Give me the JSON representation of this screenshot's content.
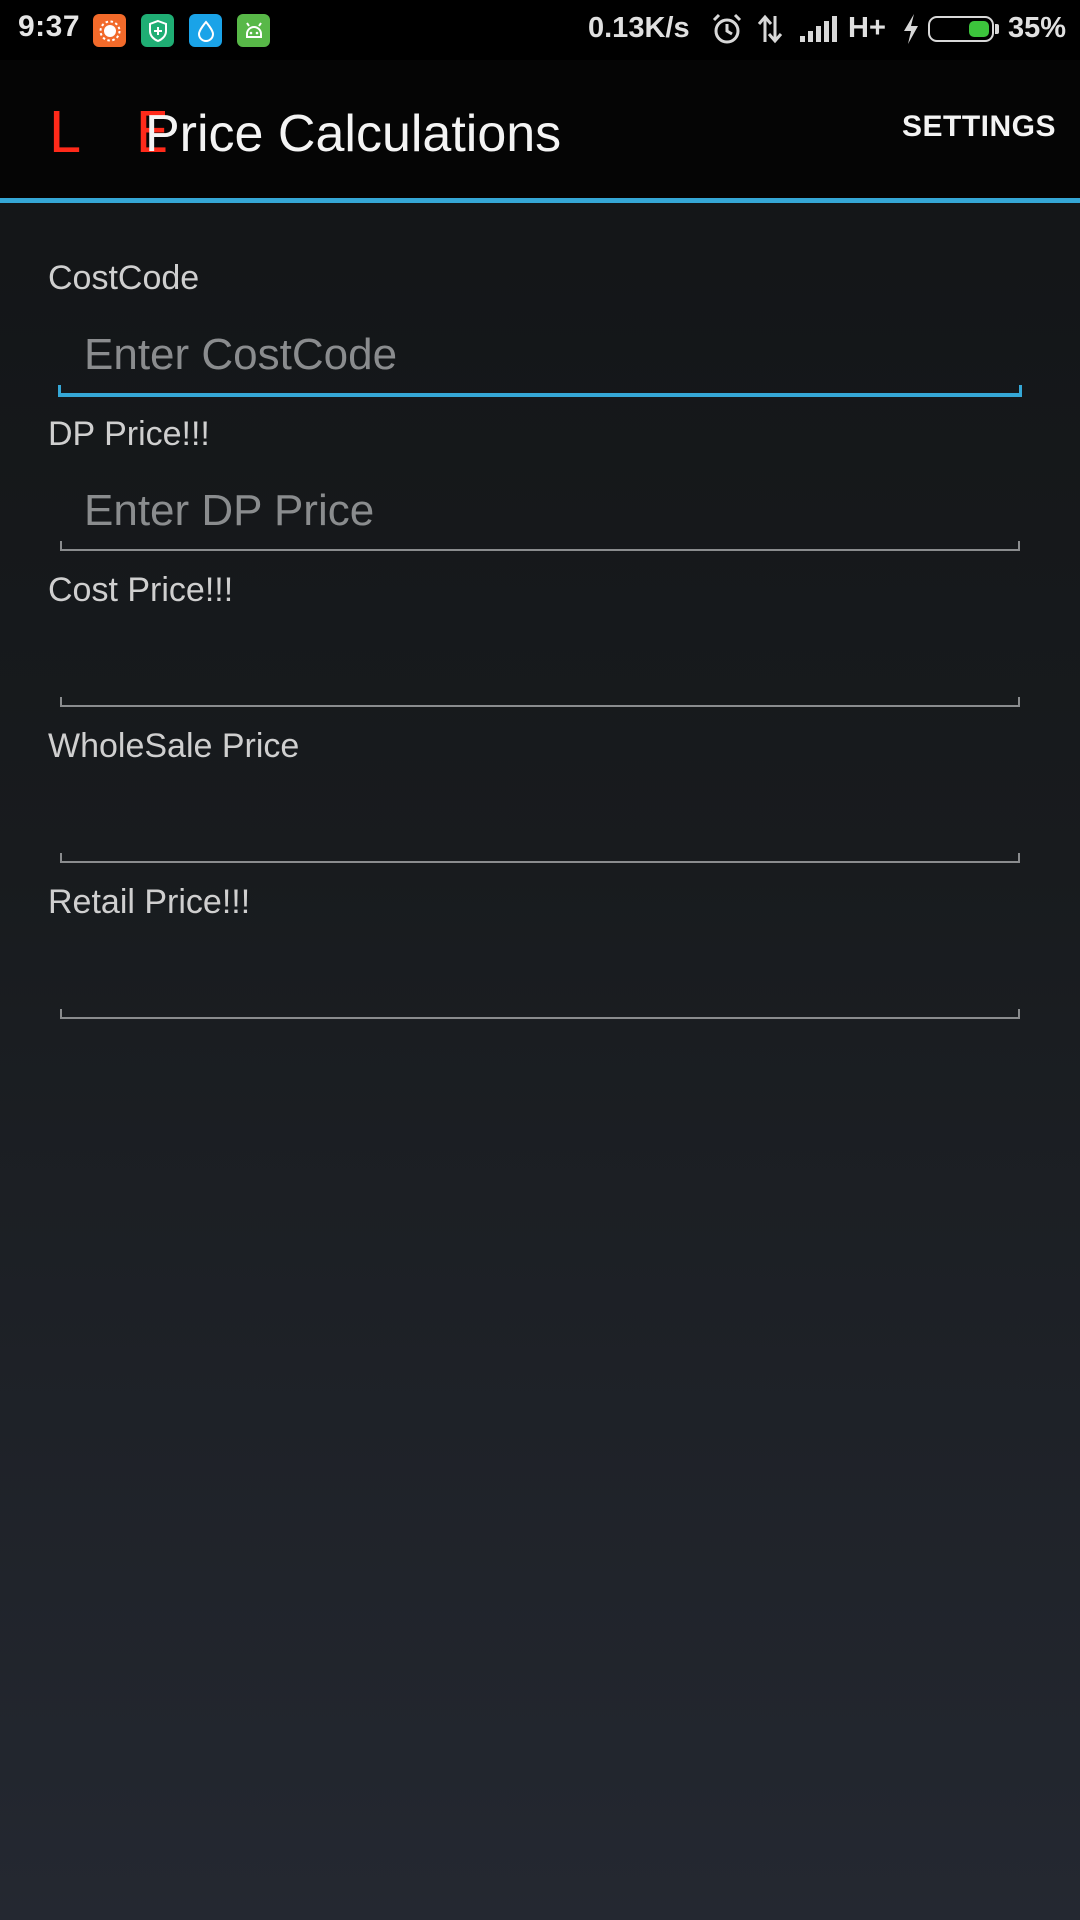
{
  "status_bar": {
    "time": "9:37",
    "notification_icons": [
      "weather-sun-icon",
      "shield-plus-icon",
      "water-drop-icon",
      "android-icon"
    ],
    "notification_colors": [
      "#f26a2a",
      "#1fae74",
      "#1aa3e8",
      "#58b848"
    ],
    "net_speed": "0.13K/s",
    "network_type": "H+",
    "battery_percent": "35%",
    "battery_level": 0.35
  },
  "action_bar": {
    "logo": "L E",
    "title": "Price Calculations",
    "settings_label": "SETTINGS",
    "accent_color": "#35a7d6"
  },
  "form": {
    "fields": [
      {
        "label": "CostCode",
        "placeholder": "Enter CostCode",
        "value": "",
        "focused": true
      },
      {
        "label": "DP Price!!!",
        "placeholder": "Enter DP Price",
        "value": ""
      },
      {
        "label": "Cost Price!!!",
        "placeholder": "",
        "value": ""
      },
      {
        "label": "WholeSale Price",
        "placeholder": "",
        "value": ""
      },
      {
        "label": "Retail Price!!!",
        "placeholder": "",
        "value": ""
      }
    ]
  }
}
